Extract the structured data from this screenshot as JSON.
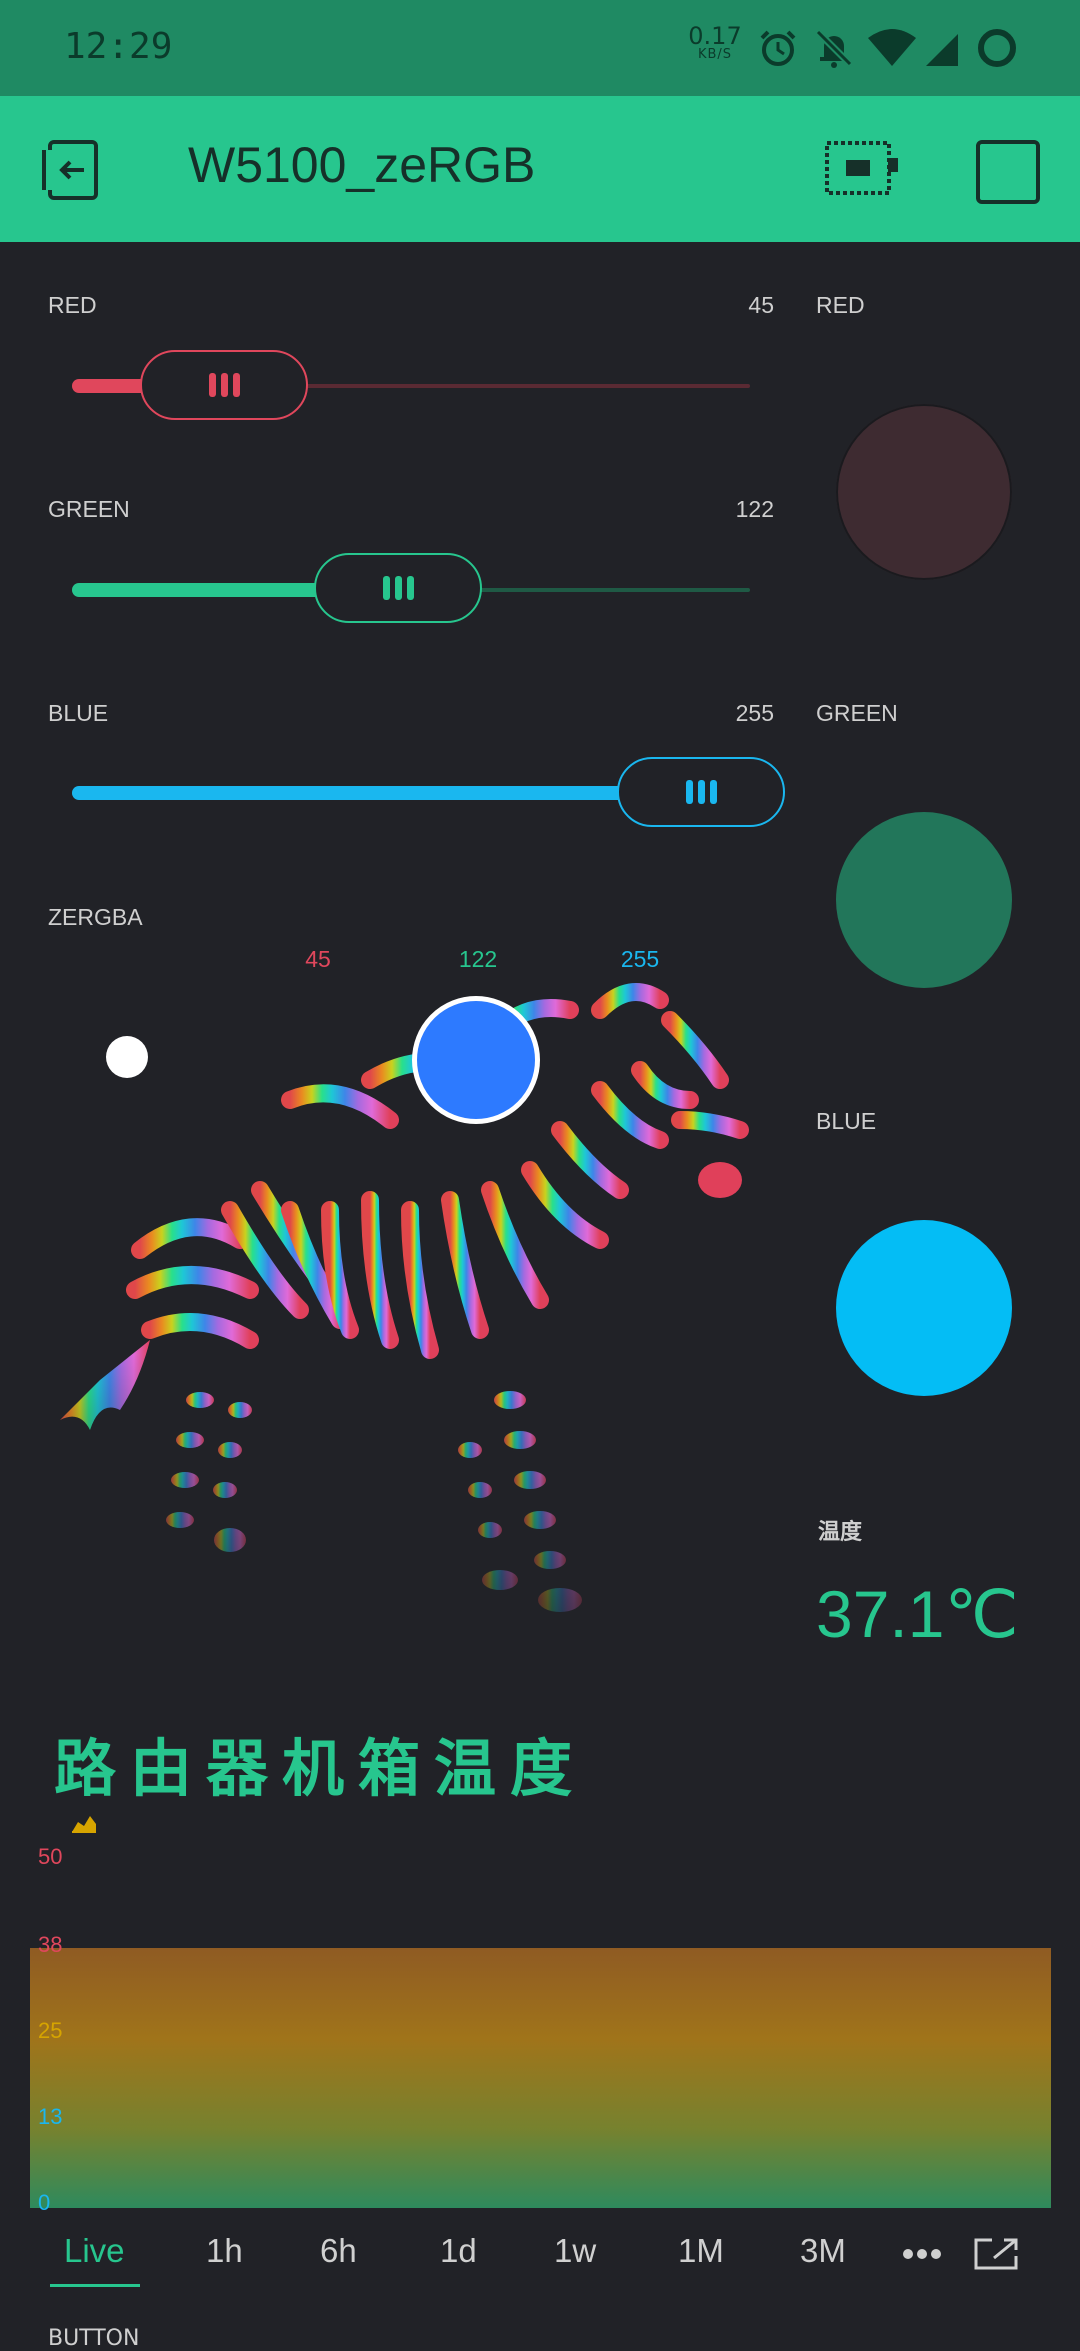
{
  "status": {
    "time": "12:29",
    "speed_value": "0.17",
    "speed_unit": "KB/S",
    "icons": [
      "alarm-icon",
      "bell-off-icon",
      "wifi-icon",
      "signal-icon",
      "battery-ring-icon"
    ]
  },
  "appbar": {
    "title": "W5100_zeRGB",
    "icons": [
      "exit-icon",
      "device-board-icon",
      "stop-square-icon"
    ]
  },
  "sliders": [
    {
      "label": "RED",
      "value": "45",
      "fraction": 0.176,
      "color": "#e0475c",
      "track": "#5a2a33"
    },
    {
      "label": "GREEN",
      "value": "122",
      "fraction": 0.478,
      "color": "#27c68e",
      "track": "#1f5a45"
    },
    {
      "label": "BLUE",
      "value": "255",
      "fraction": 1.0,
      "color": "#1ab7ef",
      "track": "#165a78"
    }
  ],
  "zergba": {
    "label": "ZERGBA",
    "r": "45",
    "g": "122",
    "b": "255",
    "r_color": "#e0475c",
    "g_color": "#27c68e",
    "b_color": "#1ab7ef",
    "picked_color": "#2d7aff"
  },
  "leds": [
    {
      "label": "RED",
      "color": "#3e2b31"
    },
    {
      "label": "GREEN",
      "color": "#22765a"
    },
    {
      "label": "BLUE",
      "color": "#04bdf5"
    }
  ],
  "temperature": {
    "label": "温度",
    "value": "37.1℃"
  },
  "chart_data": {
    "type": "area",
    "title": "路由器机箱温度",
    "ylim": [
      0,
      50
    ],
    "yticks": [
      "50",
      "38",
      "25",
      "13",
      "0"
    ],
    "values": [
      37.1,
      37.1,
      37.1,
      37.1,
      37.1,
      37.1,
      37.1,
      37.1
    ]
  },
  "tabs": [
    "Live",
    "1h",
    "6h",
    "1d",
    "1w",
    "1M",
    "3M"
  ],
  "tab_active": "Live",
  "next_widget_label": "BUTTON"
}
